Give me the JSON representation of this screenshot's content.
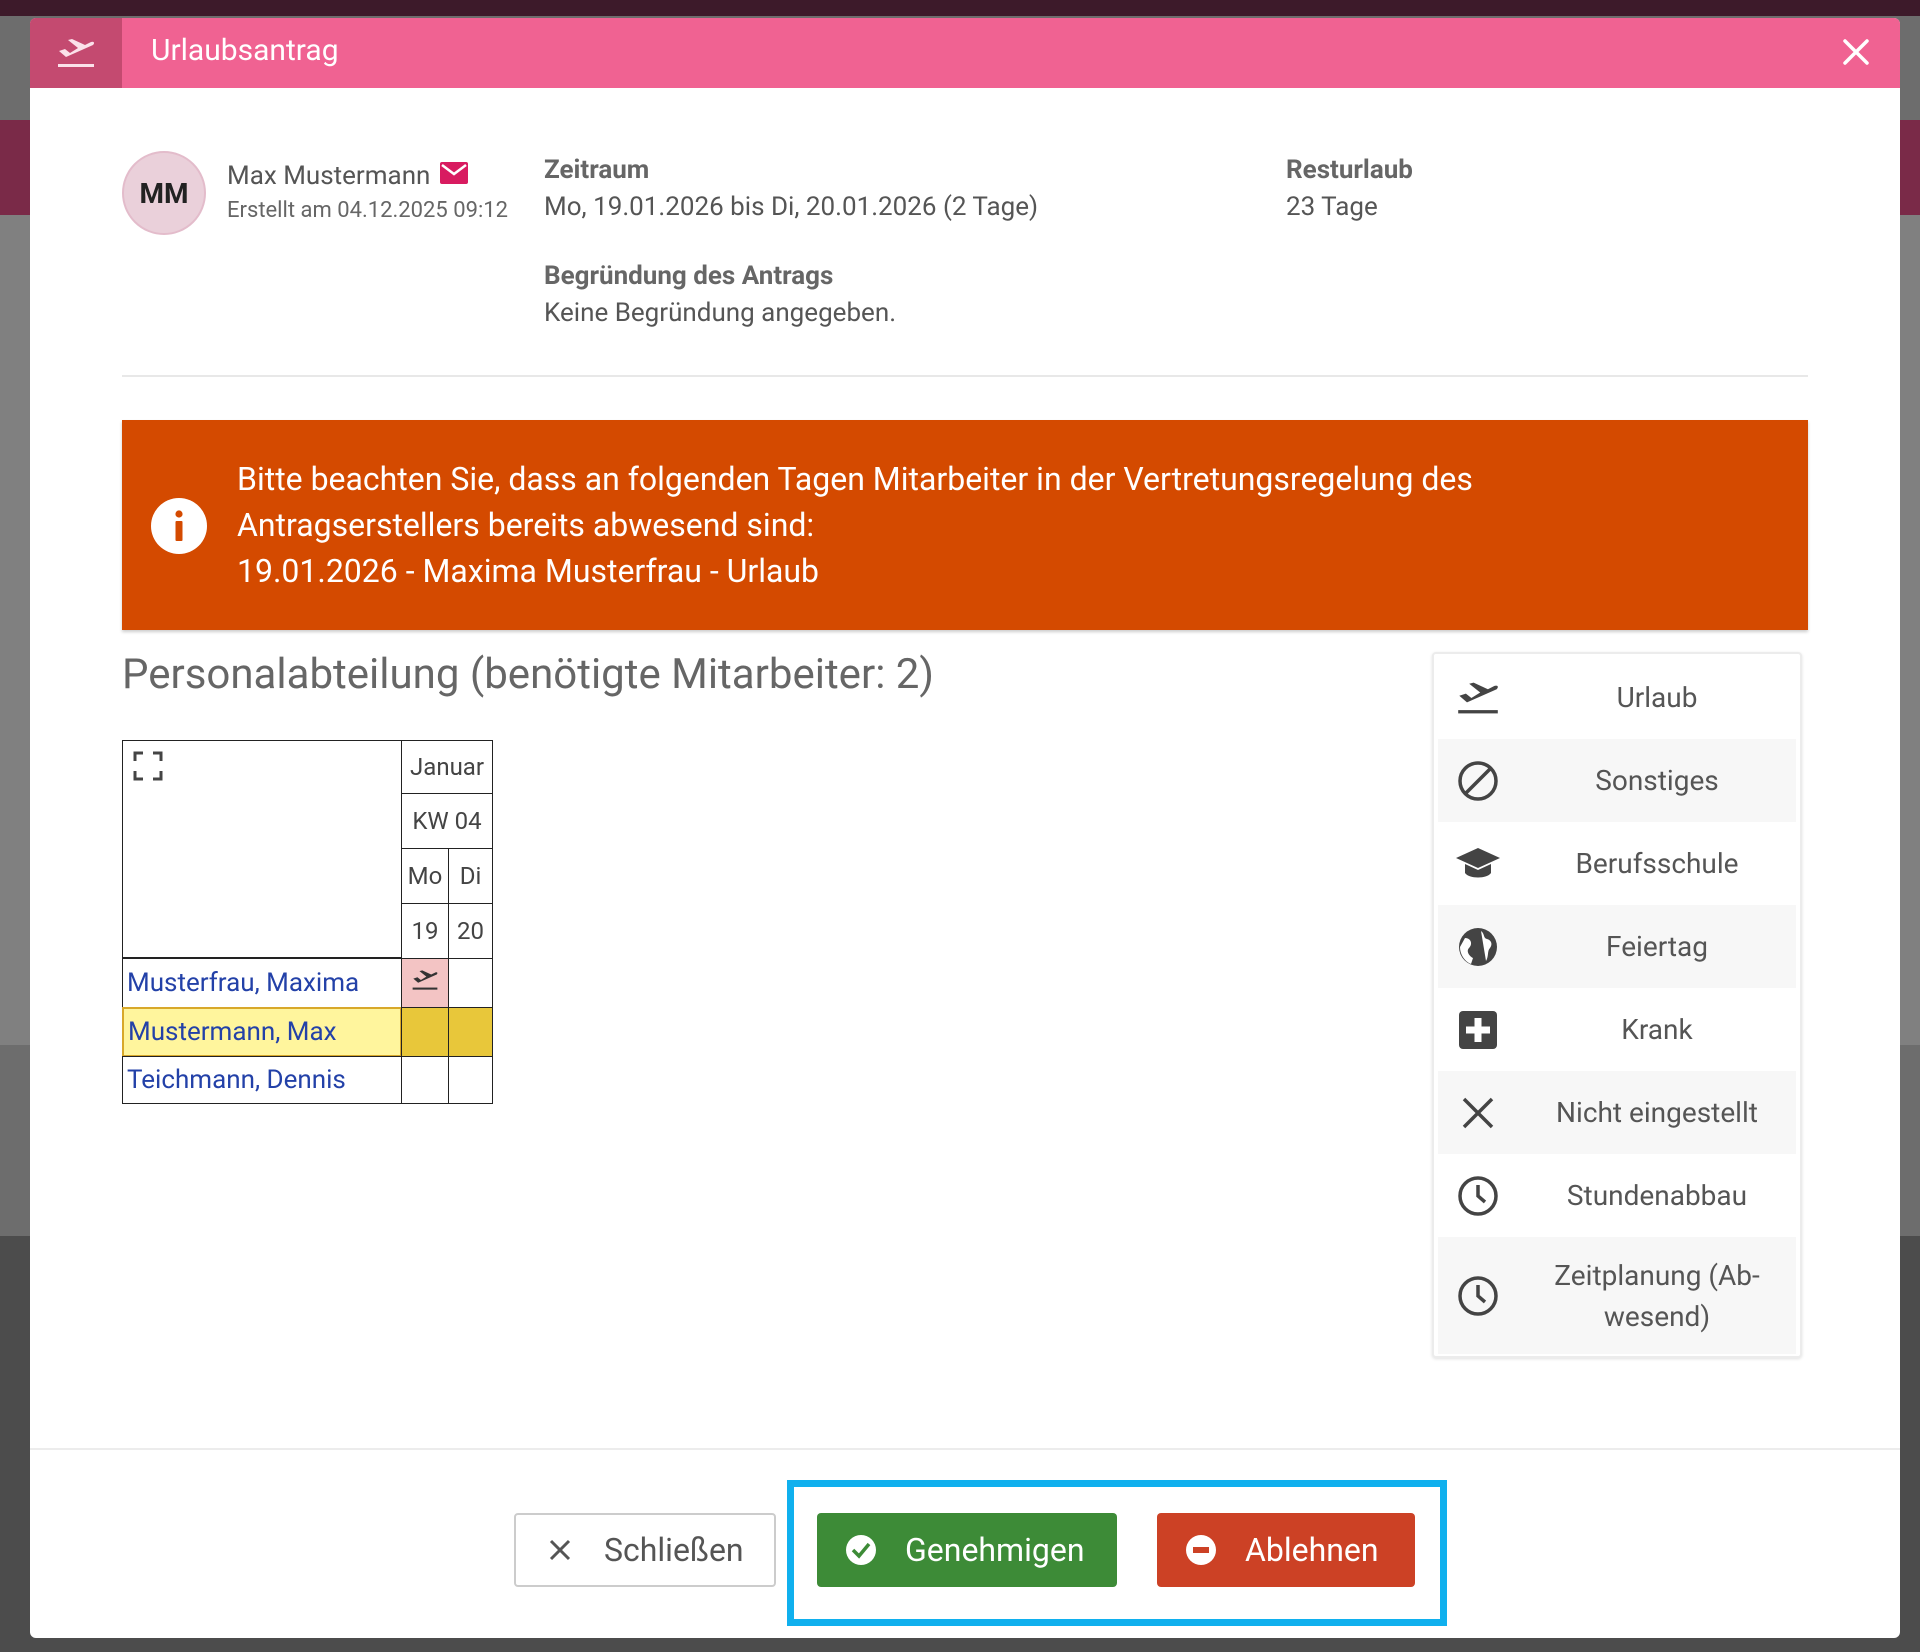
{
  "dialog": {
    "title": "Urlaubsantrag",
    "header_icon": "plane-departure-icon",
    "close_icon": "close-icon"
  },
  "requester": {
    "initials": "MM",
    "name": "Max Mustermann",
    "created": "Erstellt am 04.12.2025 09:12",
    "mail_icon": "envelope-icon",
    "mail_icon_color": "#d81b60"
  },
  "details": {
    "period_label": "Zeitraum",
    "period_value": "Mo, 19.01.2026 bis Di, 20.01.2026 (2 Tage)",
    "remaining_label": "Resturlaub",
    "remaining_value": "23 Tage",
    "reason_label": "Begründung des Antrags",
    "reason_value": "Keine Begründung angegeben."
  },
  "alert": {
    "color": "#d44a00",
    "icon": "info-icon",
    "line1": "Bitte beachten Sie, dass an folgenden Tagen Mitarbeiter in der Vertretungsregelung des",
    "line2": "Antragserstellers bereits abwesend sind:",
    "line3": "19.01.2026 - Maxima Musterfrau - Urlaub"
  },
  "department": {
    "title": "Personalabteilung (benötigte Mitarbeiter: 2)"
  },
  "calendar": {
    "expand_icon": "expand-icon",
    "month": "Januar",
    "week": "KW 04",
    "days": [
      "Mo",
      "Di"
    ],
    "dates": [
      "19",
      "20"
    ],
    "employees": [
      {
        "name": "Musterfrau, Maxima",
        "day1": "vacation",
        "day2": ""
      },
      {
        "name": "Mustermann, Max",
        "day1": "requested",
        "day2": "requested"
      },
      {
        "name": "Teichmann, Dennis",
        "day1": "",
        "day2": ""
      }
    ]
  },
  "legend": [
    {
      "icon": "plane-departure-icon",
      "label": "Urlaub"
    },
    {
      "icon": "ban-icon",
      "label": "Sonstiges"
    },
    {
      "icon": "graduation-cap-icon",
      "label": "Berufsschule"
    },
    {
      "icon": "globe-icon",
      "label": "Feiertag"
    },
    {
      "icon": "medical-plus-icon",
      "label": "Krank"
    },
    {
      "icon": "x-icon",
      "label": "Nicht eingestellt"
    },
    {
      "icon": "clock-icon",
      "label": "Stundenabbau"
    },
    {
      "icon": "clock-icon",
      "label": "Zeitplanung (Ab-\nwesend)"
    }
  ],
  "footer": {
    "close_label": "Schließen",
    "approve_label": "Genehmigen",
    "reject_label": "Ablehnen",
    "approve_color": "#3d8b37",
    "reject_color": "#cc4125",
    "highlight_color": "#10b0ee"
  }
}
